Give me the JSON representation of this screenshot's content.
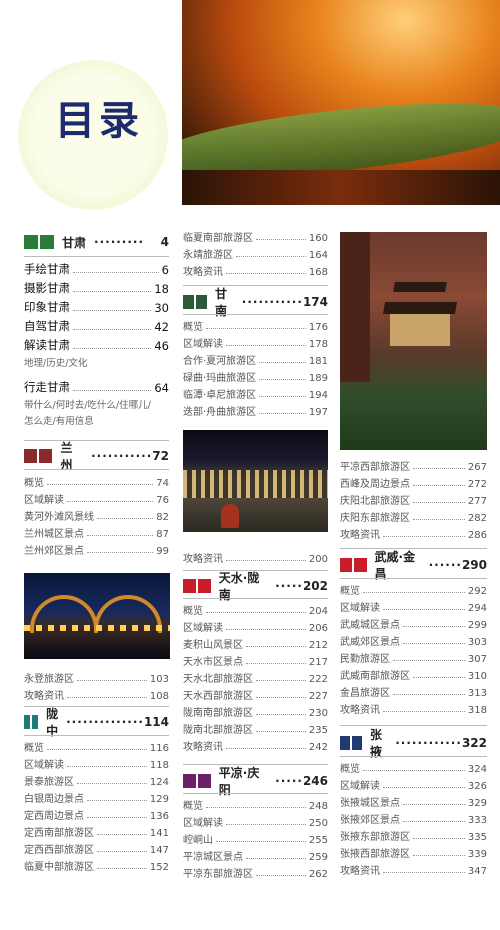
{
  "page_title": "目录",
  "colors": {
    "green": "#2a7a38",
    "teal": "#1f7a78",
    "red": "#c81e2a",
    "purple": "#6b2068",
    "navy": "#1e2a6e",
    "darkred": "#8a2a2a"
  },
  "sections": {
    "gansu": {
      "title": "甘肃",
      "dots": "·········",
      "page": "4",
      "color": "#2a7a38"
    },
    "lanzhou": {
      "title": "兰州",
      "dots": "···········",
      "page": "72",
      "color": "#8a2a2a"
    },
    "longzhong": {
      "title": "陇中",
      "dots": "··············",
      "page": "114",
      "color": "#1f7a78"
    },
    "gannan": {
      "title": "甘南",
      "dots": "···········",
      "page": "174",
      "color": "#2a5a3a"
    },
    "tianshui": {
      "title": "天水·陇南",
      "dots": "·····",
      "page": "202",
      "color": "#c81e2a"
    },
    "pingliang": {
      "title": "平凉·庆阳",
      "dots": "·····",
      "page": "246",
      "color": "#6b2068"
    },
    "wuwei": {
      "title": "武威·金昌",
      "dots": "······",
      "page": "290",
      "color": "#c81e2a"
    },
    "zhangye": {
      "title": "张掖",
      "dots": "············",
      "page": "322",
      "color": "#1e3a6e"
    }
  },
  "col1_top": [
    {
      "label": "手绘甘肃",
      "page": "6"
    },
    {
      "label": "摄影甘肃",
      "page": "18"
    },
    {
      "label": "印象甘肃",
      "page": "30"
    },
    {
      "label": "自驾甘肃",
      "page": "42"
    },
    {
      "label": "解读甘肃",
      "page": "46"
    }
  ],
  "col1_note1": "地理/历史/文化",
  "col1_walk": {
    "label": "行走甘肃",
    "page": "64"
  },
  "col1_note2a": "带什么/何时去/吃什么/住哪儿/",
  "col1_note2b": "怎么走/有用信息",
  "lanzhou_items": [
    {
      "label": "概览",
      "page": "74"
    },
    {
      "label": "区域解读",
      "page": "76"
    },
    {
      "label": "黄河外滩风景线",
      "page": "82"
    },
    {
      "label": "兰州城区景点",
      "page": "87"
    },
    {
      "label": "兰州郊区景点",
      "page": "99"
    }
  ],
  "lanzhou_items2": [
    {
      "label": "永登旅游区",
      "page": "103"
    },
    {
      "label": "攻略资讯",
      "page": "108"
    }
  ],
  "longzhong_items": [
    {
      "label": "概览",
      "page": "116"
    },
    {
      "label": "区域解读",
      "page": "118"
    },
    {
      "label": "景泰旅游区",
      "page": "124"
    },
    {
      "label": "白银周边景点",
      "page": "129"
    },
    {
      "label": "定西周边景点",
      "page": "136"
    },
    {
      "label": "定西南部旅游区",
      "page": "141"
    },
    {
      "label": "定西西部旅游区",
      "page": "147"
    },
    {
      "label": "临夏中部旅游区",
      "page": "152"
    }
  ],
  "col2_top": [
    {
      "label": "临夏南部旅游区",
      "page": "160"
    },
    {
      "label": "永靖旅游区",
      "page": "164"
    },
    {
      "label": "攻略资讯",
      "page": "168"
    }
  ],
  "gannan_items": [
    {
      "label": "概览",
      "page": "176"
    },
    {
      "label": "区域解读",
      "page": "178"
    },
    {
      "label": "合作·夏河旅游区",
      "page": "181"
    },
    {
      "label": "碌曲·玛曲旅游区",
      "page": "189"
    },
    {
      "label": "临潭·卓尼旅游区",
      "page": "194"
    },
    {
      "label": "迭部·舟曲旅游区",
      "page": "197"
    }
  ],
  "gannan_items2": [
    {
      "label": "攻略资讯",
      "page": "200"
    }
  ],
  "tianshui_items": [
    {
      "label": "概览",
      "page": "204"
    },
    {
      "label": "区域解读",
      "page": "206"
    },
    {
      "label": "麦积山风景区",
      "page": "212"
    },
    {
      "label": "天水市区景点",
      "page": "217"
    },
    {
      "label": "天水北部旅游区",
      "page": "222"
    },
    {
      "label": "天水西部旅游区",
      "page": "227"
    },
    {
      "label": "陇南南部旅游区",
      "page": "230"
    },
    {
      "label": "陇南北部旅游区",
      "page": "235"
    },
    {
      "label": "攻略资讯",
      "page": "242"
    }
  ],
  "pingliang_items": [
    {
      "label": "概览",
      "page": "248"
    },
    {
      "label": "区域解读",
      "page": "250"
    },
    {
      "label": "崆峒山",
      "page": "255"
    },
    {
      "label": "平凉城区景点",
      "page": "259"
    },
    {
      "label": "平凉东部旅游区",
      "page": "262"
    }
  ],
  "col3_top": [
    {
      "label": "平凉西部旅游区",
      "page": "267"
    },
    {
      "label": "西峰及周边景点",
      "page": "272"
    },
    {
      "label": "庆阳北部旅游区",
      "page": "277"
    },
    {
      "label": "庆阳东部旅游区",
      "page": "282"
    },
    {
      "label": "攻略资讯",
      "page": "286"
    }
  ],
  "wuwei_items": [
    {
      "label": "概览",
      "page": "292"
    },
    {
      "label": "区域解读",
      "page": "294"
    },
    {
      "label": "武威城区景点",
      "page": "299"
    },
    {
      "label": "武威郊区景点",
      "page": "303"
    },
    {
      "label": "民勤旅游区",
      "page": "307"
    },
    {
      "label": "武威南部旅游区",
      "page": "310"
    },
    {
      "label": "金昌旅游区",
      "page": "313"
    },
    {
      "label": "攻略资讯",
      "page": "318"
    }
  ],
  "zhangye_items": [
    {
      "label": "概览",
      "page": "324"
    },
    {
      "label": "区域解读",
      "page": "326"
    },
    {
      "label": "张掖城区景点",
      "page": "329"
    },
    {
      "label": "张掖郊区景点",
      "page": "333"
    },
    {
      "label": "张掖东部旅游区",
      "page": "335"
    },
    {
      "label": "张掖西部旅游区",
      "page": "339"
    },
    {
      "label": "攻略资讯",
      "page": "347"
    }
  ]
}
